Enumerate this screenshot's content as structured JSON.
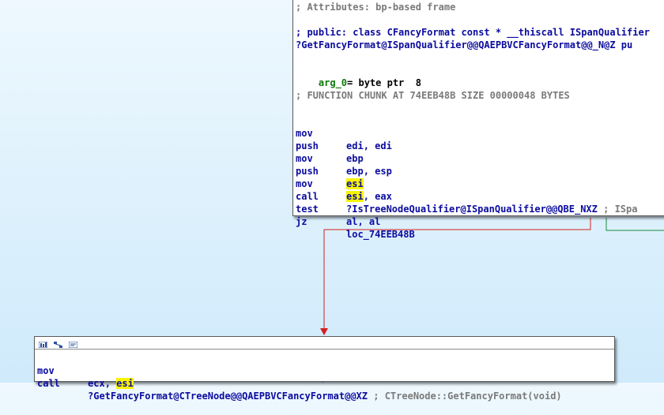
{
  "top_node": {
    "comment_attrs": "; Attributes: bp-based frame",
    "proto_line1": "; public: class CFancyFormat const * __thiscall ISpanQualifier",
    "proto_line2": "?GetFancyFormat@ISpanQualifier@@QAEPBVCFancyFormat@@_N@Z pu",
    "arg_name": "arg_0",
    "arg_def": "= byte ptr  8",
    "chunk_comment": "; FUNCTION CHUNK AT 74EEB48B SIZE 00000048 BYTES",
    "instructions": [
      {
        "mnemonic": "mov",
        "op1": "edi",
        "sep": ", ",
        "op2": "edi",
        "comment": ""
      },
      {
        "mnemonic": "push",
        "op1": "ebp",
        "sep": "",
        "op2": "",
        "comment": ""
      },
      {
        "mnemonic": "mov",
        "op1": "ebp",
        "sep": ", ",
        "op2": "esp",
        "comment": ""
      },
      {
        "mnemonic": "push",
        "op1": "esi",
        "sep": "",
        "op2": "",
        "comment": ""
      },
      {
        "mnemonic": "mov",
        "op1": "esi",
        "sep": ", ",
        "op2": "eax",
        "comment": ""
      },
      {
        "mnemonic": "call",
        "op1": "?IsTreeNodeQualifier@ISpanQualifier@@QBE_NXZ",
        "sep": "",
        "op2": "",
        "comment": " ; ISpa"
      },
      {
        "mnemonic": "test",
        "op1": "al",
        "sep": ", ",
        "op2": "al",
        "comment": ""
      },
      {
        "mnemonic": "jz",
        "op1": "loc_74EEB48B",
        "sep": "",
        "op2": "",
        "comment": ""
      }
    ]
  },
  "bottom_node": {
    "instructions": [
      {
        "mnemonic": "mov",
        "op1": "ecx",
        "sep": ", ",
        "op2": "esi",
        "comment": ""
      },
      {
        "mnemonic": "call",
        "op1": "?GetFancyFormat@CTreeNode@@QAEPBVCFancyFormat@@XZ",
        "sep": "",
        "op2": "",
        "comment": " ; CTreeNode::GetFancyFormat(void)"
      }
    ]
  },
  "highlight_register": "esi",
  "colors": {
    "edge_false": "#d42020",
    "edge_true": "#1a8a3a",
    "edge_other": "#1c3fa0",
    "highlight": "#f8f400"
  },
  "titlebar_icons": [
    "graph-color-icon",
    "group-nodes-icon",
    "node-text-icon"
  ]
}
